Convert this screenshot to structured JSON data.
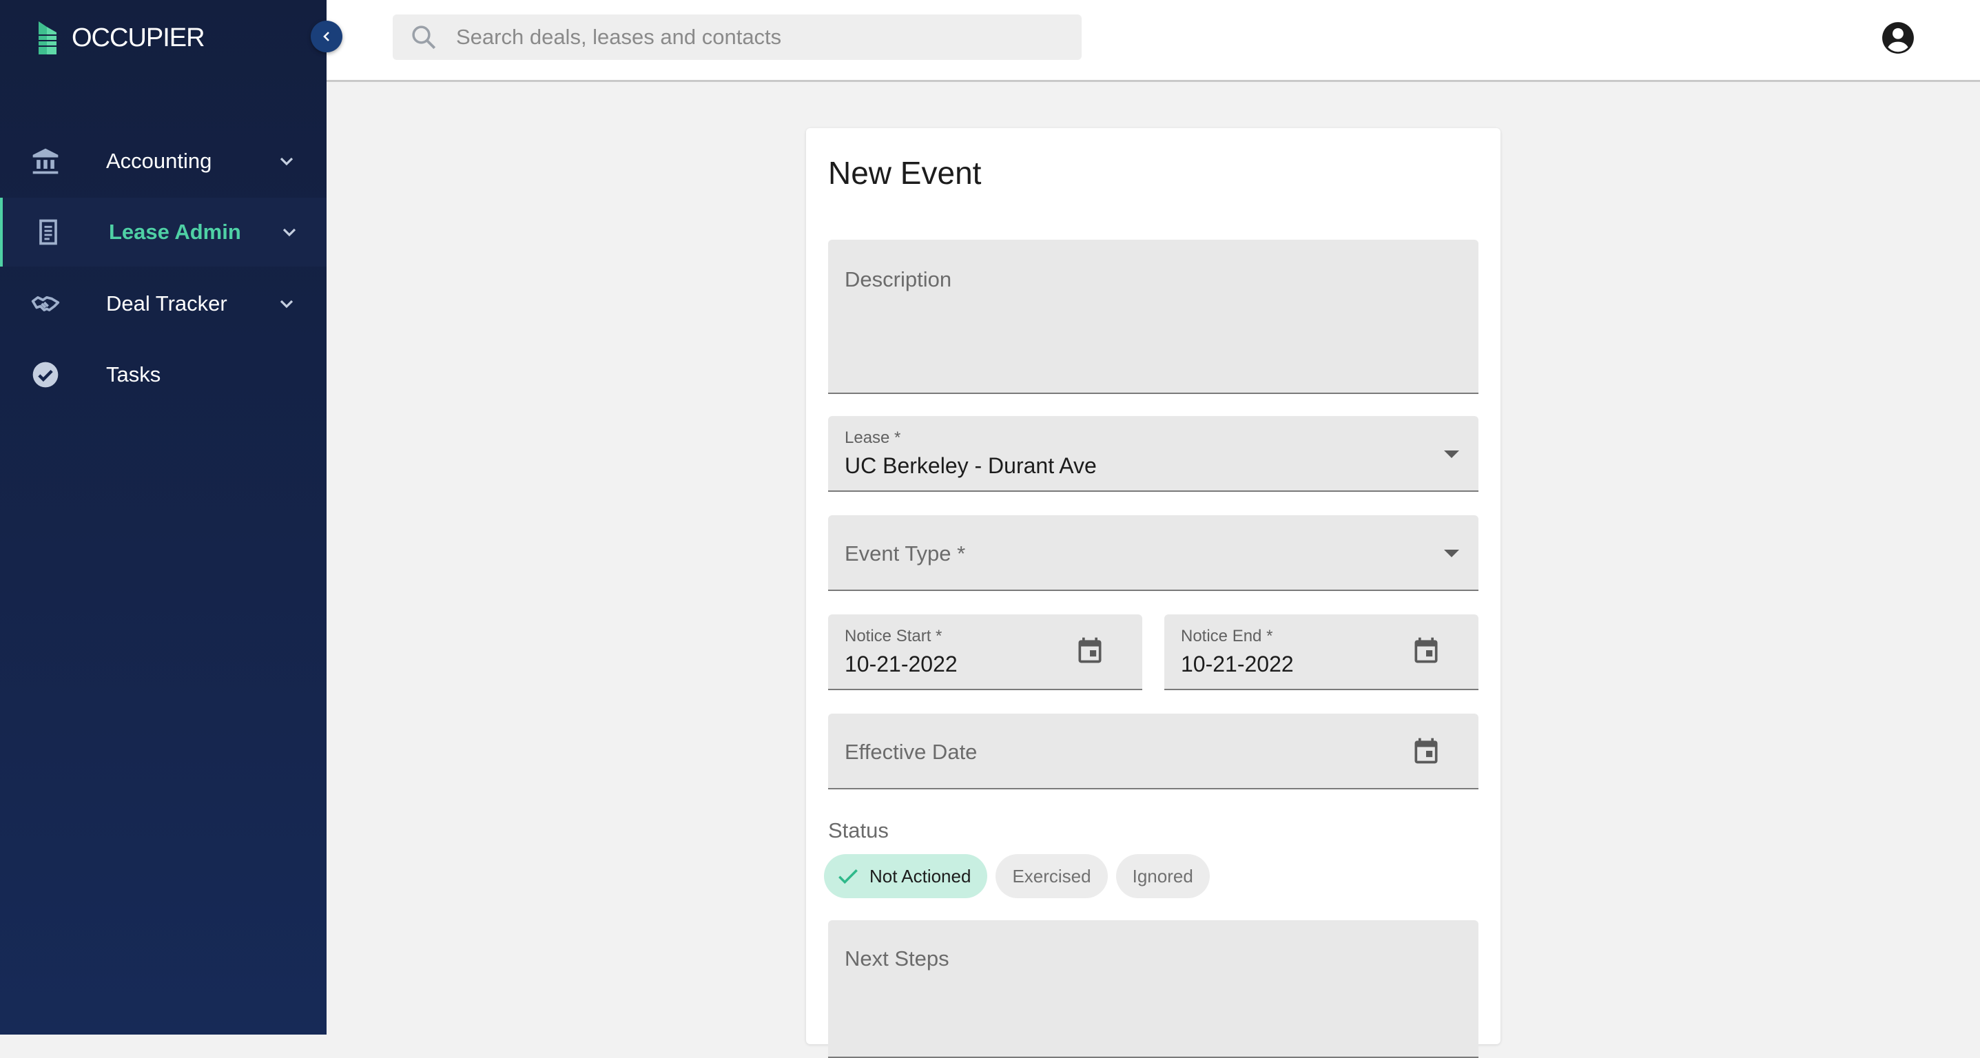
{
  "app": {
    "logo_text": "OCCUPIER",
    "accent_color": "#4fd1a5",
    "sidebar_color": "#131f3f"
  },
  "sidebar": {
    "items": [
      {
        "label": "Accounting",
        "icon": "bank-icon",
        "active": false,
        "expandable": true
      },
      {
        "label": "Lease Admin",
        "icon": "document-icon",
        "active": true,
        "expandable": true
      },
      {
        "label": "Deal Tracker",
        "icon": "handshake-icon",
        "active": false,
        "expandable": true
      },
      {
        "label": "Tasks",
        "icon": "check-circle-icon",
        "active": false,
        "expandable": false
      }
    ]
  },
  "header": {
    "search_placeholder": "Search deals, leases and contacts"
  },
  "form": {
    "title": "New Event",
    "description": {
      "placeholder": "Description",
      "value": ""
    },
    "lease": {
      "label": "Lease *",
      "value": "UC Berkeley - Durant Ave"
    },
    "event_type": {
      "placeholder": "Event Type *",
      "value": ""
    },
    "notice_start": {
      "label": "Notice Start *",
      "value": "10-21-2022"
    },
    "notice_end": {
      "label": "Notice End *",
      "value": "10-21-2022"
    },
    "effective_date": {
      "placeholder": "Effective Date",
      "value": ""
    },
    "status": {
      "label": "Status",
      "options": [
        "Not Actioned",
        "Exercised",
        "Ignored"
      ],
      "selected": "Not Actioned"
    },
    "next_steps": {
      "placeholder": "Next Steps",
      "value": ""
    }
  }
}
